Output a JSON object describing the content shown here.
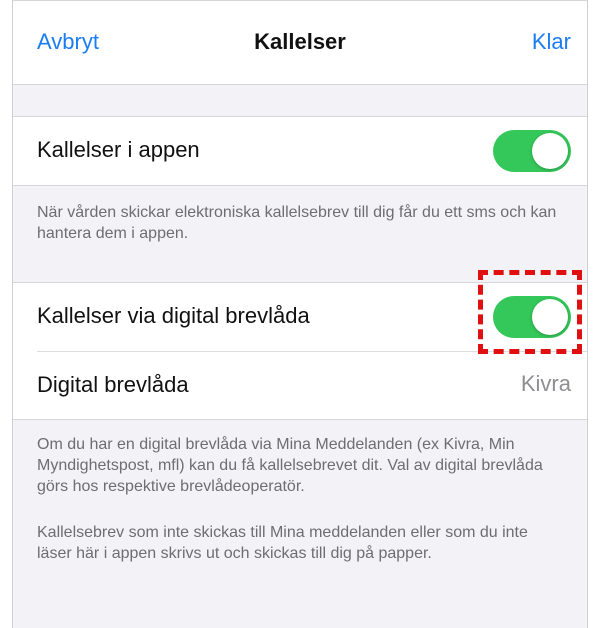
{
  "navbar": {
    "cancel_label": "Avbryt",
    "title": "Kallelser",
    "done_label": "Klar"
  },
  "section_app": {
    "toggle_label": "Kallelser i appen",
    "toggle_on": true,
    "footnote": "När vården skickar elektroniska kallelsebrev till dig får du ett sms och kan hantera dem i appen."
  },
  "section_digital": {
    "toggle_label": "Kallelser via digital brevlåda",
    "toggle_on": true,
    "mailbox_label": "Digital brevlåda",
    "mailbox_value": "Kivra",
    "footnote_1": "Om du har en digital brevlåda via Mina Meddelanden (ex Kivra, Min Myndighetspost, mfl) kan du få kallelsebrevet dit. Val av digital brevlåda görs hos respektive brevlådeoperatör.",
    "footnote_2": "Kallelsebrev som inte skickas till Mina meddelanden eller som du inte läser här i appen skrivs ut och skickas till dig på papper."
  },
  "colors": {
    "accent": "#1c7cf3",
    "toggle_on": "#34c759",
    "highlight": "#e01010",
    "background": "#f2f2f7"
  }
}
